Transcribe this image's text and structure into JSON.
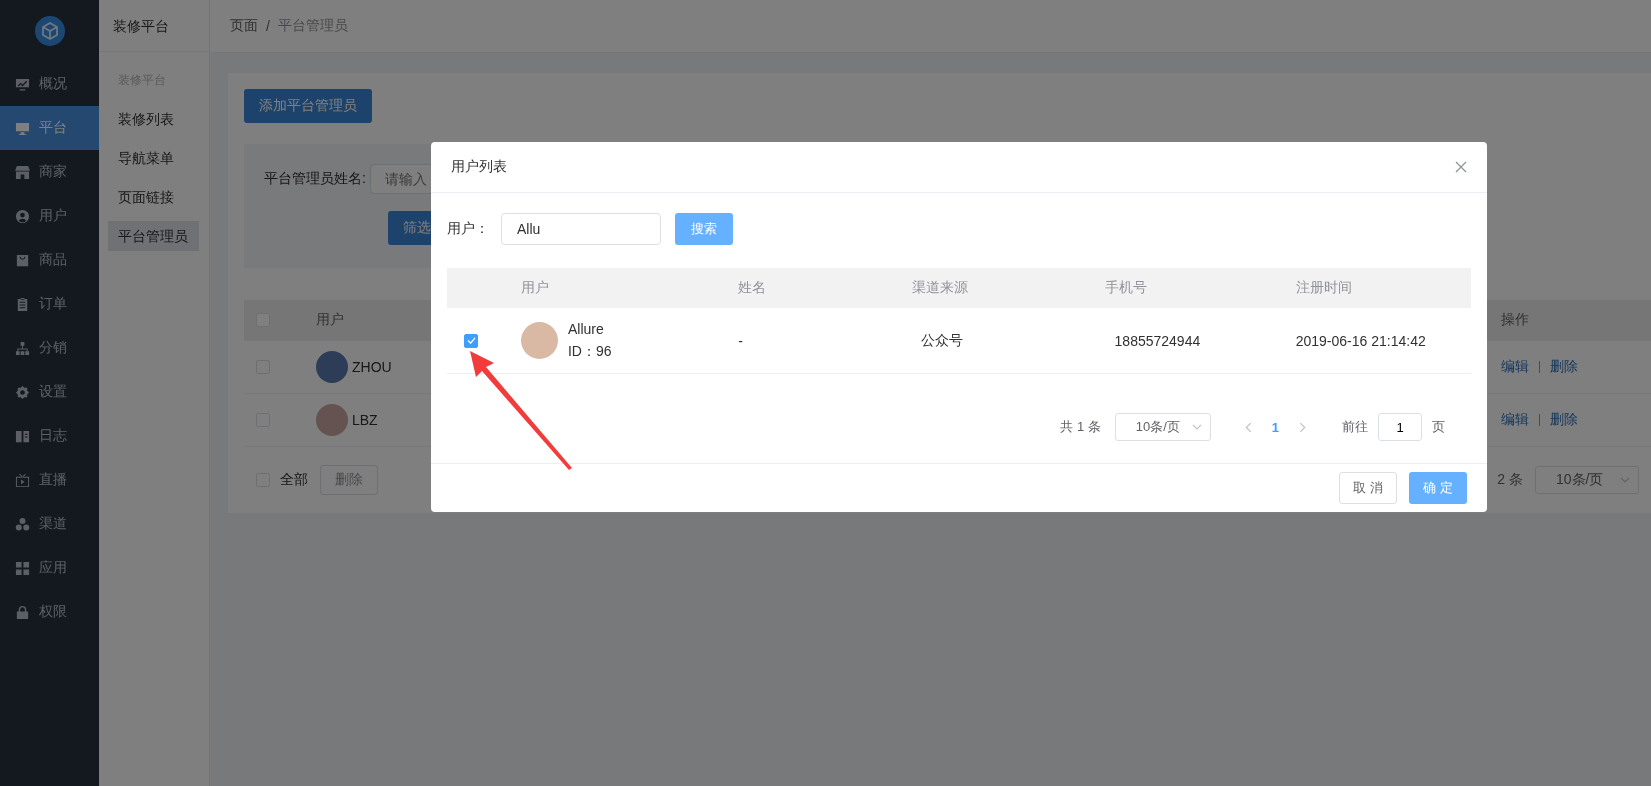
{
  "sidebar": {
    "items": [
      {
        "label": "概况",
        "selected": false
      },
      {
        "label": "平台",
        "selected": true
      },
      {
        "label": "商家",
        "selected": false
      },
      {
        "label": "用户",
        "selected": false
      },
      {
        "label": "商品",
        "selected": false
      },
      {
        "label": "订单",
        "selected": false
      },
      {
        "label": "分销",
        "selected": false
      },
      {
        "label": "设置",
        "selected": false
      },
      {
        "label": "日志",
        "selected": false
      },
      {
        "label": "直播",
        "selected": false
      },
      {
        "label": "渠道",
        "selected": false
      },
      {
        "label": "应用",
        "selected": false
      },
      {
        "label": "权限",
        "selected": false
      }
    ]
  },
  "submenu": {
    "title": "装修平台",
    "group": "装修平台",
    "items": [
      {
        "label": "装修列表",
        "selected": false
      },
      {
        "label": "导航菜单",
        "selected": false
      },
      {
        "label": "页面链接",
        "selected": false
      },
      {
        "label": "平台管理员",
        "selected": true
      }
    ]
  },
  "breadcrumb": [
    "页面",
    "/",
    "平台管理员"
  ],
  "page": {
    "add_button": "添加平台管理员",
    "filter": {
      "label": "平台管理员姓名:",
      "placeholder": "请输入",
      "button": "筛选"
    },
    "table": {
      "header_checked": false,
      "columns": [
        "用户",
        "操作"
      ],
      "rows": [
        {
          "checked": false,
          "name": "ZHOU",
          "actions": [
            "编辑",
            "删除"
          ]
        },
        {
          "checked": false,
          "name": "LBZ",
          "actions": [
            "编辑",
            "删除"
          ]
        }
      ]
    },
    "footer": {
      "select_all": {
        "label": "全部",
        "checked": false
      },
      "delete_button": "删除",
      "total": "2 条",
      "page_size": "10条/页"
    }
  },
  "modal": {
    "title": "用户列表",
    "search": {
      "label": "用户：",
      "value": "Allu",
      "button": "搜索"
    },
    "table": {
      "columns": [
        "用户",
        "姓名",
        "渠道来源",
        "手机号",
        "注册时间"
      ],
      "rows": [
        {
          "checked": true,
          "name": "Allure",
          "id": "ID：96",
          "real_name": "-",
          "channel": "公众号",
          "phone": "18855724944",
          "registered": "2019-06-16 21:14:42"
        }
      ]
    },
    "pagination": {
      "total": "共 1 条",
      "page_size": "10条/页",
      "pages": [
        {
          "label": "1",
          "selected": true
        }
      ],
      "goto_label": "前往",
      "goto_value": "1",
      "goto_suffix": "页"
    },
    "buttons": {
      "cancel": "取 消",
      "confirm": "确 定"
    }
  }
}
